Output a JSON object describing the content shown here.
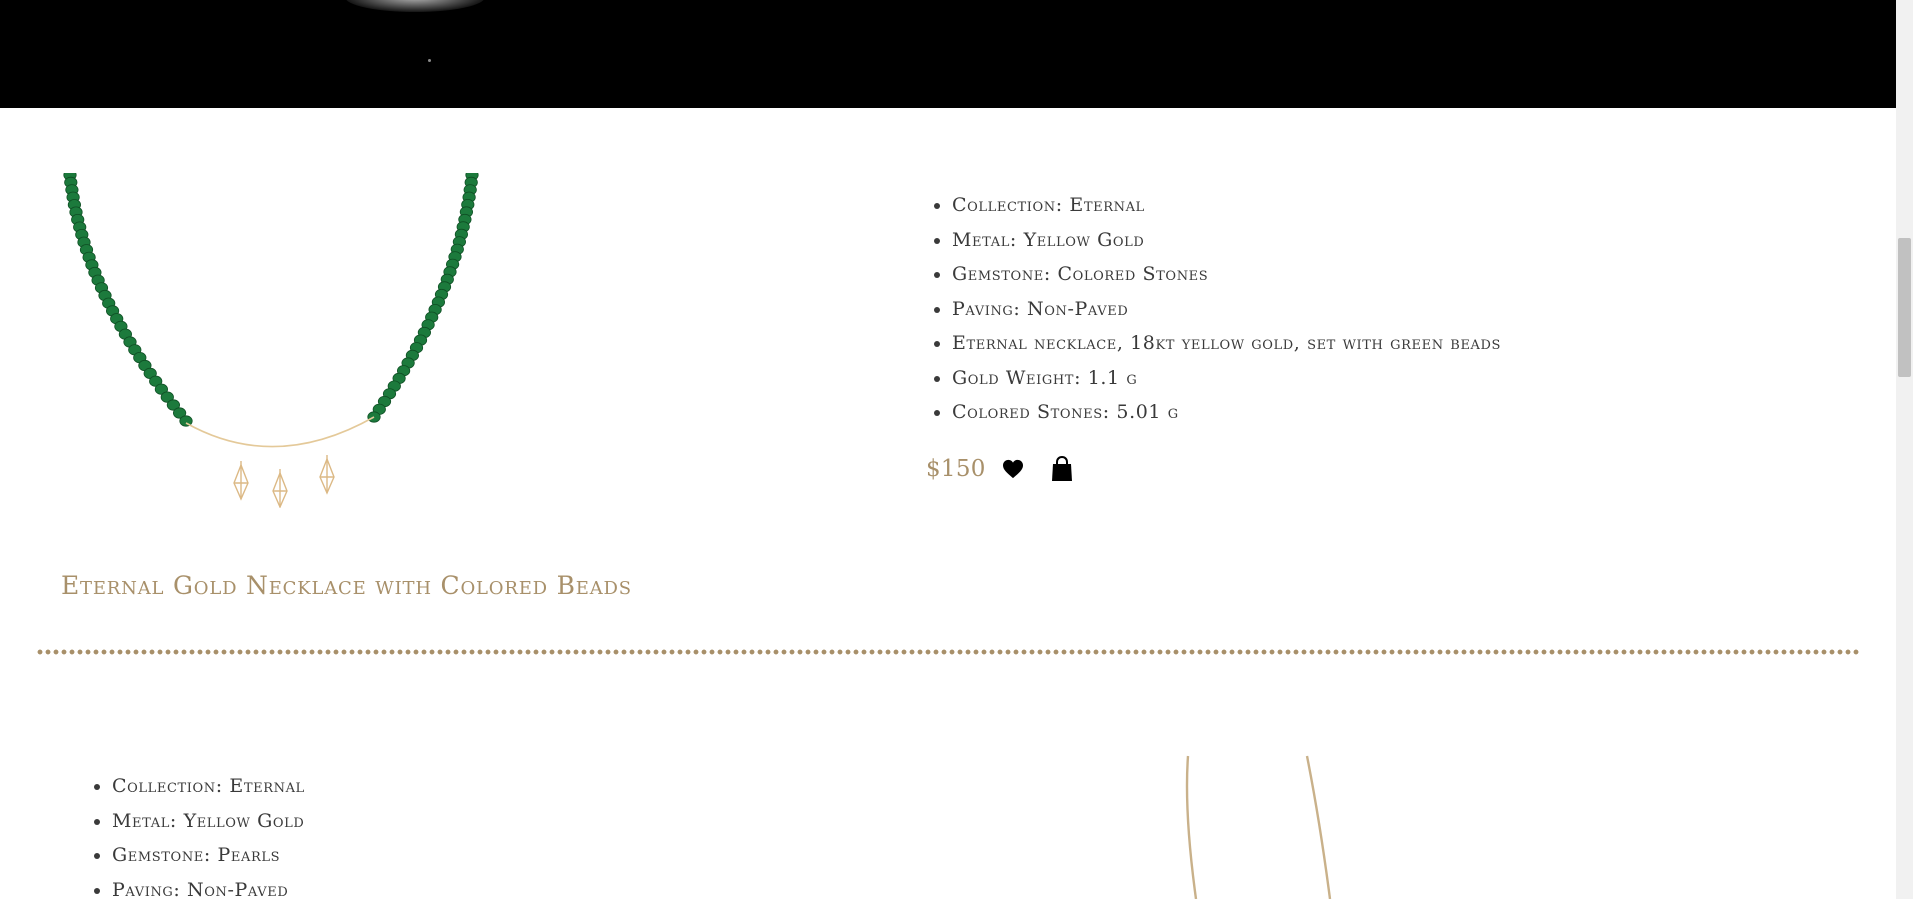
{
  "colors": {
    "accent_gold": "#a8906a",
    "text_dark": "#3a3a3a",
    "hero_background": "#000000",
    "bead_green": "#1c7a3c",
    "chain_gold": "#e4c999"
  },
  "products": [
    {
      "title": "Eternal Gold Necklace with Colored Beads",
      "specs": [
        "Collection: Eternal",
        "Metal: Yellow Gold",
        "Gemstone: Colored Stones",
        "Paving: Non-Paved",
        "Eternal necklace, 18kt yellow gold, set with green beads",
        "Gold Weight: 1.1 g",
        "Colored Stones: 5.01 g"
      ],
      "price": "$150",
      "icons": {
        "wishlist": "heart-icon",
        "cart": "shopping-bag-icon"
      }
    },
    {
      "specs": [
        "Collection: Eternal",
        "Metal: Yellow Gold",
        "Gemstone: Pearls",
        "Paving: Non-Paved"
      ]
    }
  ]
}
